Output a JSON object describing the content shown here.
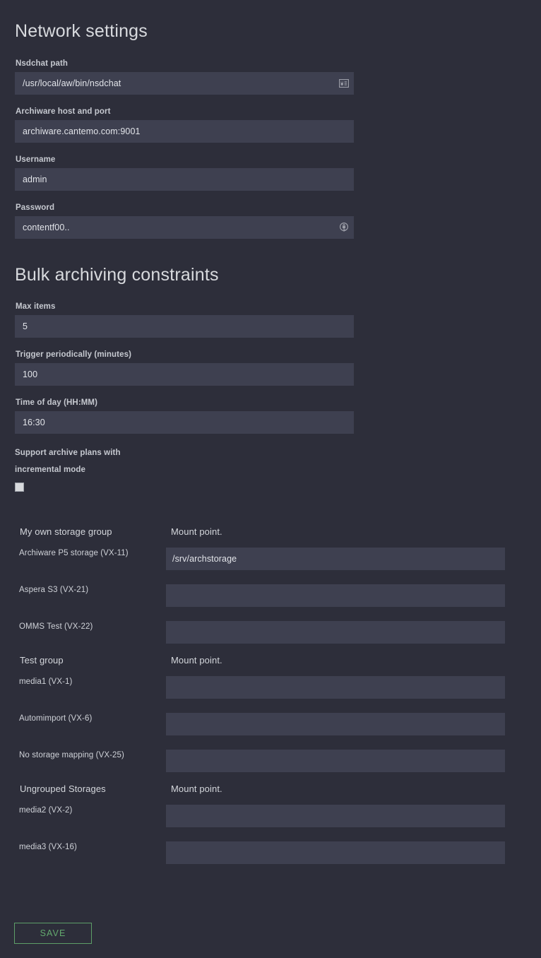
{
  "network": {
    "title": "Network settings",
    "fields": [
      {
        "label": "Nsdchat path",
        "value": "/usr/local/aw/bin/nsdchat",
        "placeholder": "",
        "icon": "contact-card-icon"
      },
      {
        "label": "Archiware host and port",
        "value": "archiware.cantemo.com:9001",
        "placeholder": "",
        "icon": ""
      },
      {
        "label": "Username",
        "value": "admin",
        "placeholder": "",
        "icon": ""
      },
      {
        "label": "Password",
        "value": "contentf00..",
        "placeholder": "",
        "icon": "lock-icon"
      }
    ]
  },
  "bulk": {
    "title": "Bulk archiving constraints",
    "fields": [
      {
        "label": "Max items",
        "value": "5",
        "placeholder": ""
      },
      {
        "label": "Trigger periodically (minutes)",
        "value": "100",
        "placeholder": ""
      },
      {
        "label": "Time of day (HH:MM)",
        "value": "16:30",
        "placeholder": ""
      }
    ],
    "checkbox": {
      "label_line1": "Support archive plans with",
      "label_line2": "incremental mode",
      "checked": false
    }
  },
  "storage": {
    "mount_point_header": "Mount point.",
    "groups": [
      {
        "name": "My own storage group",
        "rows": [
          {
            "name": "Archiware P5 storage (VX-11)",
            "value": "/srv/archstorage",
            "placeholder": ""
          },
          {
            "name": "Aspera S3 (VX-21)",
            "value": "",
            "placeholder": ""
          },
          {
            "name": "OMMS Test (VX-22)",
            "value": "",
            "placeholder": ""
          }
        ]
      },
      {
        "name": "Test group",
        "rows": [
          {
            "name": "media1 (VX-1)",
            "value": "",
            "placeholder": ""
          },
          {
            "name": "Automimport (VX-6)",
            "value": "",
            "placeholder": ""
          },
          {
            "name": "No storage mapping (VX-25)",
            "value": "",
            "placeholder": ""
          }
        ]
      },
      {
        "name": "Ungrouped Storages",
        "rows": [
          {
            "name": "media2 (VX-2)",
            "value": "",
            "placeholder": ""
          },
          {
            "name": "media3 (VX-16)",
            "value": "",
            "placeholder": ""
          }
        ]
      }
    ]
  },
  "actions": {
    "save_label": "SAVE"
  },
  "colors": {
    "background": "#2d2e3a",
    "input_background": "#3e4050",
    "text": "#d7d9de",
    "accent_green": "#5d9e68"
  }
}
